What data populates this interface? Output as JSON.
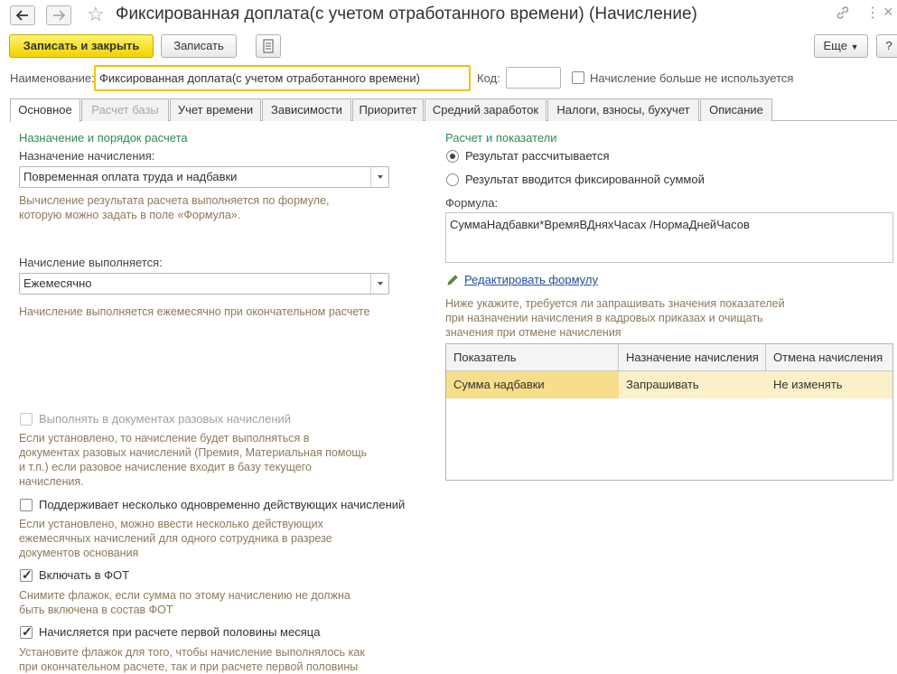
{
  "window": {
    "title": "Фиксированная доплата(с учетом отработанного времени) (Начисление)"
  },
  "toolbar": {
    "save_close": "Записать и закрыть",
    "save": "Записать",
    "more": "Еще",
    "help": "?"
  },
  "header": {
    "name_label": "Наименование:",
    "name_value": "Фиксированная доплата(с учетом отработанного времени)",
    "code_label": "Код:",
    "code_value": "",
    "not_used_label": "Начисление больше не используется",
    "not_used_checked": false
  },
  "tabs": [
    {
      "label": "Основное",
      "active": true
    },
    {
      "label": "Расчет базы",
      "disabled": true
    },
    {
      "label": "Учет времени"
    },
    {
      "label": "Зависимости"
    },
    {
      "label": "Приоритет"
    },
    {
      "label": "Средний заработок"
    },
    {
      "label": "Налоги, взносы, бухучет"
    },
    {
      "label": "Описание"
    }
  ],
  "left": {
    "section_title": "Назначение и порядок расчета",
    "purpose_label": "Назначение начисления:",
    "purpose_value": "Повременная оплата труда и надбавки",
    "purpose_hint_1": "Вычисление результата расчета выполняется по формуле,",
    "purpose_hint_2": "которую можно задать в поле «Формула».",
    "frequency_label": "Начисление выполняется:",
    "frequency_value": "Ежемесячно",
    "frequency_hint": "Начисление выполняется ежемесячно при окончательном расчете",
    "onetime_label": "Выполнять в документах разовых начислений",
    "onetime_hint": [
      "Если установлено, то начисление будет выполняться в",
      "документах разовых начислений (Премия, Материальная помощь",
      "и т.п.) если разовое начисление входит в базу текущего",
      "начисления."
    ],
    "multiple_label": "Поддерживает несколько одновременно действующих начислений",
    "multiple_hint": [
      "Если установлено, можно ввести несколько действующих",
      "ежемесячных начислений для одного сотрудника в разрезе",
      "документов основания"
    ],
    "fot_label": "Включать в ФОТ",
    "fot_hint": [
      "Снимите флажок, если сумма по этому начислению не должна",
      "быть включена в состав ФОТ"
    ],
    "first_half_label": "Начисляется при расчете первой половины месяца",
    "first_half_hint": [
      "Установите флажок для того, чтобы начисление выполнялось как",
      "при окончательном расчете, так и при расчете первой половины"
    ]
  },
  "right": {
    "section_title": "Расчет и показатели",
    "radio_calc": "Результат рассчитывается",
    "radio_fixed": "Результат вводится фиксированной суммой",
    "formula_label": "Формула:",
    "formula_value": "СуммаНадбавки*ВремяВДняхЧасах /НормаДнейЧасов",
    "edit_formula": "Редактировать формулу",
    "indicators_hint": [
      "Ниже укажите, требуется ли запрашивать значения показателей",
      "при назначении начисления в кадровых приказах и очищать",
      "значения при отмене начисления"
    ],
    "table": {
      "columns": [
        "Показатель",
        "Назначение начисления",
        "Отмена начисления"
      ],
      "rows": [
        [
          "Сумма надбавки",
          "Запрашивать",
          "Не изменять"
        ]
      ]
    }
  },
  "colors": {
    "primary_button": "#f2d200",
    "section_title": "#2e8b57",
    "hint_text": "#8c7a5b",
    "selected_row": "#fbf0c8",
    "link": "#1f4e9c"
  }
}
